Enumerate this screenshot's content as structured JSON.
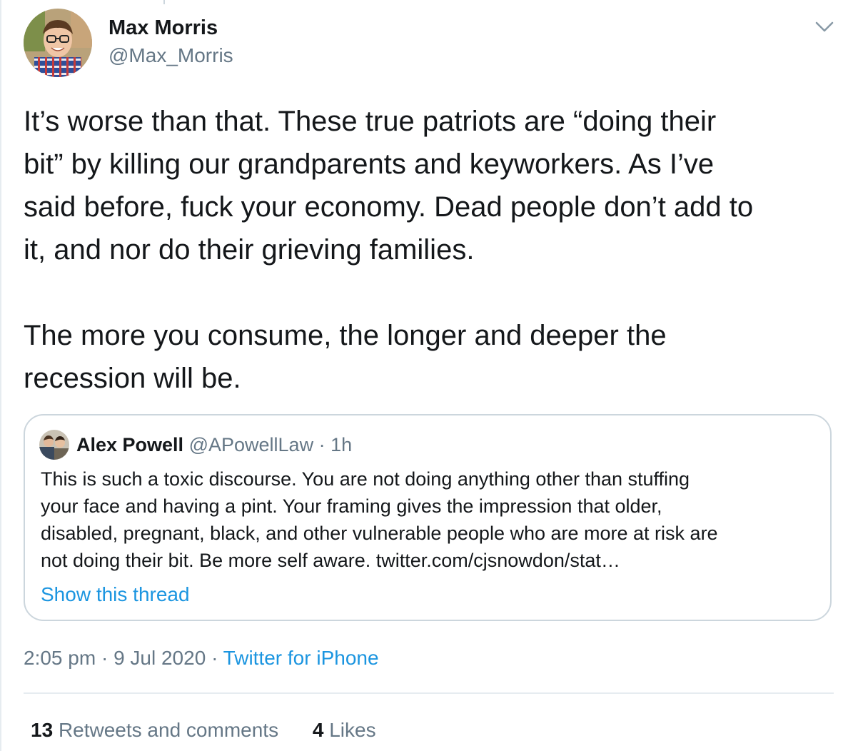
{
  "tweet": {
    "author": {
      "display_name": "Max Morris",
      "handle": "@Max_Morris"
    },
    "text_lines": [
      "It’s worse than that. These true patriots are “doing their",
      "bit” by killing our grandparents and keyworkers. As I’ve",
      "said before, fuck your economy. Dead people don’t add to",
      "it, and nor do their grieving families.",
      "",
      "The more you consume, the longer and deeper the",
      "recession will be."
    ],
    "quoted": {
      "display_name": "Alex Powell",
      "handle": "@APowellLaw",
      "separator": "·",
      "time": "1h",
      "text_lines": [
        "This is such a toxic discourse. You are not doing anything other than stuffing",
        "your face and having a pint. Your framing gives the impression that older,",
        "disabled, pregnant, black, and other vulnerable people who are more at risk are",
        "not doing their bit. Be more self aware. twitter.com/cjsnowdon/stat…"
      ],
      "show_thread": "Show this thread"
    },
    "meta": {
      "time": "2:05 pm",
      "separator": "·",
      "date": "9 Jul 2020",
      "source": "Twitter for iPhone"
    },
    "stats": {
      "retweets_count": "13",
      "retweets_label": "Retweets and comments",
      "likes_count": "4",
      "likes_label": "Likes"
    }
  },
  "icons": {
    "menu": "chevron-down-icon",
    "avatar": "profile-photo",
    "quoted_avatar": "profile-photo"
  },
  "colors": {
    "text": "#14171a",
    "secondary": "#657786",
    "link": "#1b95e0",
    "border": "#ccd6dd"
  }
}
